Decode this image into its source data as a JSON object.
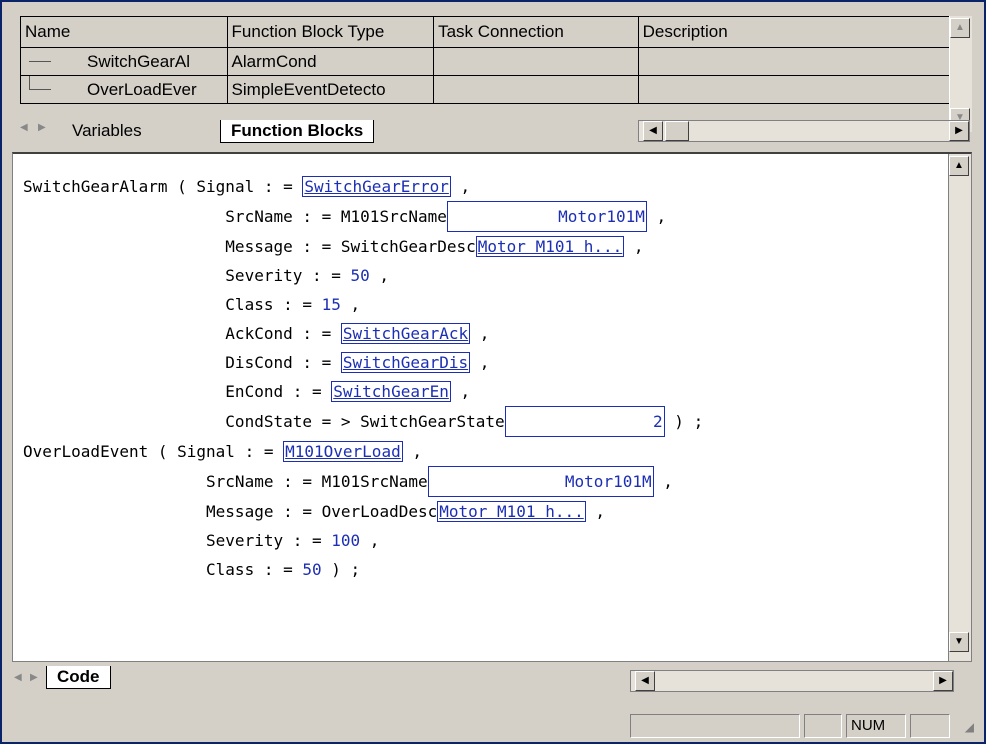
{
  "grid": {
    "headers": [
      "Name",
      "Function Block Type",
      "Task Connection",
      "Description"
    ],
    "rows": [
      {
        "name": "SwitchGearAl",
        "type": "AlarmCond",
        "task": "",
        "desc": ""
      },
      {
        "name": "OverLoadEver",
        "type": "SimpleEventDetecto",
        "task": "",
        "desc": ""
      }
    ]
  },
  "tabs": {
    "variables": "Variables",
    "function_blocks": "Function Blocks"
  },
  "code": {
    "b1": {
      "name": "SwitchGearAlarm",
      "signal_param": "Signal",
      "signal_val": "SwitchGearError",
      "src_param": "SrcName",
      "src_var": "M101SrcName",
      "src_val": "Motor101M",
      "msg_param": "Message",
      "msg_var": "SwitchGearDesc",
      "msg_val": "Motor M101 h...",
      "sev_param": "Severity",
      "sev_val": "50",
      "class_param": "Class",
      "class_val": "15",
      "ack_param": "AckCond",
      "ack_val": "SwitchGearAck",
      "dis_param": "DisCond",
      "dis_val": "SwitchGearDis",
      "en_param": "EnCond",
      "en_val": "SwitchGearEn",
      "cs_param": "CondState",
      "cs_var": "SwitchGearState",
      "cs_val": "2"
    },
    "b2": {
      "name": "OverLoadEvent",
      "signal_param": "Signal",
      "signal_val": "M101OverLoad",
      "src_param": "SrcName",
      "src_var": "M101SrcName",
      "src_val": "Motor101M",
      "msg_param": "Message",
      "msg_var": "OverLoadDesc",
      "msg_val": "Motor M101 h...",
      "sev_param": "Severity",
      "sev_val": "100",
      "class_param": "Class",
      "class_val": "50"
    }
  },
  "code_tab": "Code",
  "status": {
    "num": "NUM"
  }
}
